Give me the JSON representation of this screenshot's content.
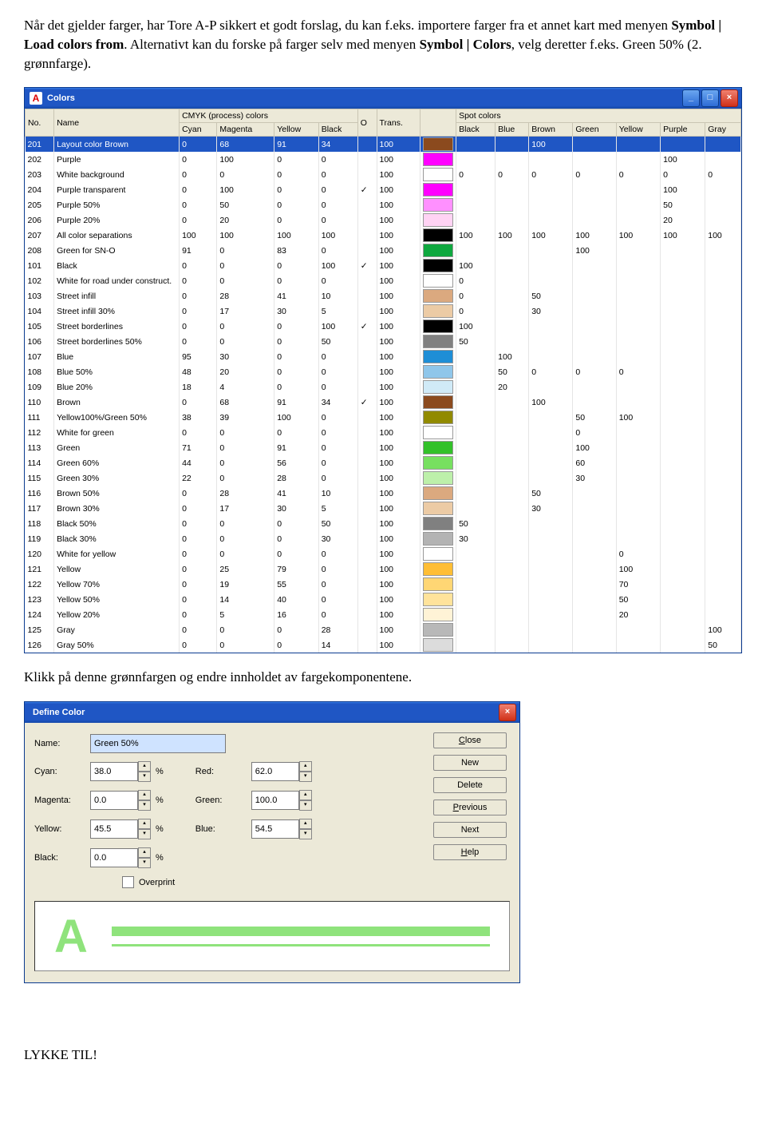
{
  "doc": {
    "p1a": "Når det gjelder farger, har Tore A-P sikkert et godt forslag, du kan f.eks. importere farger fra et annet kart med menyen ",
    "p1b": "Symbol | Load colors from",
    "p1c": ". Alternativt kan du forske på farger selv med menyen ",
    "p1d": "Symbol | Colors",
    "p1e": ", velg deretter f.eks. Green 50% (2. grønnfarge).",
    "p2": "Klikk på denne grønnfargen og endre innholdet av fargekomponentene.",
    "p3": "LYKKE TIL!"
  },
  "colorsWin": {
    "title": "Colors",
    "headers": {
      "no": "No.",
      "name": "Name",
      "group1": "CMYK (process) colors",
      "cyan": "Cyan",
      "mag": "Magenta",
      "yel": "Yellow",
      "blk": "Black",
      "o": "O",
      "trans": "Trans.",
      "group2": "Spot colors",
      "s_black": "Black",
      "s_blue": "Blue",
      "s_brown": "Brown",
      "s_green": "Green",
      "s_yellow": "Yellow",
      "s_purple": "Purple",
      "s_gray": "Gray"
    },
    "rows": [
      {
        "no": "201",
        "name": "Layout color Brown",
        "c": "0",
        "m": "68",
        "y": "91",
        "k": "34",
        "o": "",
        "t": "100",
        "sw": "#8b4a1e",
        "sc": {
          "brown": "100"
        }
      },
      {
        "no": "202",
        "name": "Purple",
        "c": "0",
        "m": "100",
        "y": "0",
        "k": "0",
        "o": "",
        "t": "100",
        "sw": "#ff00ff",
        "sc": {
          "purple": "100"
        }
      },
      {
        "no": "203",
        "name": "White background",
        "c": "0",
        "m": "0",
        "y": "0",
        "k": "0",
        "o": "",
        "t": "100",
        "sw": "#ffffff",
        "sc": {
          "black": "0",
          "blue": "0",
          "brown": "0",
          "green": "0",
          "yellow": "0",
          "purple": "0",
          "gray": "0"
        }
      },
      {
        "no": "204",
        "name": "Purple transparent",
        "c": "0",
        "m": "100",
        "y": "0",
        "k": "0",
        "o": "✓",
        "t": "100",
        "sw": "#ff00ff",
        "sc": {
          "purple": "100"
        }
      },
      {
        "no": "205",
        "name": "Purple 50%",
        "c": "0",
        "m": "50",
        "y": "0",
        "k": "0",
        "o": "",
        "t": "100",
        "sw": "#ff90ff",
        "sc": {
          "purple": "50"
        }
      },
      {
        "no": "206",
        "name": "Purple 20%",
        "c": "0",
        "m": "20",
        "y": "0",
        "k": "0",
        "o": "",
        "t": "100",
        "sw": "#ffd3f4",
        "sc": {
          "purple": "20"
        }
      },
      {
        "no": "207",
        "name": "All color separations",
        "c": "100",
        "m": "100",
        "y": "100",
        "k": "100",
        "o": "",
        "t": "100",
        "sw": "#000000",
        "sc": {
          "black": "100",
          "blue": "100",
          "brown": "100",
          "green": "100",
          "yellow": "100",
          "purple": "100",
          "gray": "100"
        }
      },
      {
        "no": "208",
        "name": "Green for SN-O",
        "c": "91",
        "m": "0",
        "y": "83",
        "k": "0",
        "o": "",
        "t": "100",
        "sw": "#0fa83f",
        "sc": {
          "green": "100"
        }
      },
      {
        "no": "101",
        "name": "Black",
        "c": "0",
        "m": "0",
        "y": "0",
        "k": "100",
        "o": "✓",
        "t": "100",
        "sw": "#000000",
        "sc": {
          "black": "100"
        }
      },
      {
        "no": "102",
        "name": "White for road under construct.",
        "c": "0",
        "m": "0",
        "y": "0",
        "k": "0",
        "o": "",
        "t": "100",
        "sw": "#ffffff",
        "sc": {
          "black": "0"
        }
      },
      {
        "no": "103",
        "name": "Street infill",
        "c": "0",
        "m": "28",
        "y": "41",
        "k": "10",
        "o": "",
        "t": "100",
        "sw": "#dba97f",
        "sc": {
          "black": "0",
          "brown": "50"
        }
      },
      {
        "no": "104",
        "name": "Street infill 30%",
        "c": "0",
        "m": "17",
        "y": "30",
        "k": "5",
        "o": "",
        "t": "100",
        "sw": "#eccba5",
        "sc": {
          "black": "0",
          "brown": "30"
        }
      },
      {
        "no": "105",
        "name": "Street borderlines",
        "c": "0",
        "m": "0",
        "y": "0",
        "k": "100",
        "o": "✓",
        "t": "100",
        "sw": "#000000",
        "sc": {
          "black": "100"
        }
      },
      {
        "no": "106",
        "name": "Street borderlines 50%",
        "c": "0",
        "m": "0",
        "y": "0",
        "k": "50",
        "o": "",
        "t": "100",
        "sw": "#808080",
        "sc": {
          "black": "50"
        }
      },
      {
        "no": "107",
        "name": "Blue",
        "c": "95",
        "m": "30",
        "y": "0",
        "k": "0",
        "o": "",
        "t": "100",
        "sw": "#1e8ed6",
        "sc": {
          "blue": "100"
        }
      },
      {
        "no": "108",
        "name": "Blue 50%",
        "c": "48",
        "m": "20",
        "y": "0",
        "k": "0",
        "o": "",
        "t": "100",
        "sw": "#8fc6ea",
        "sc": {
          "blue": "50",
          "brown": "0",
          "green": "0",
          "yellow": "0"
        }
      },
      {
        "no": "109",
        "name": "Blue 20%",
        "c": "18",
        "m": "4",
        "y": "0",
        "k": "0",
        "o": "",
        "t": "100",
        "sw": "#d0eaf7",
        "sc": {
          "blue": "20"
        }
      },
      {
        "no": "110",
        "name": "Brown",
        "c": "0",
        "m": "68",
        "y": "91",
        "k": "34",
        "o": "✓",
        "t": "100",
        "sw": "#8b4a1e",
        "sc": {
          "brown": "100"
        }
      },
      {
        "no": "111",
        "name": "Yellow100%/Green 50%",
        "c": "38",
        "m": "39",
        "y": "100",
        "k": "0",
        "o": "",
        "t": "100",
        "sw": "#918a00",
        "sc": {
          "green": "50",
          "yellow": "100"
        }
      },
      {
        "no": "112",
        "name": "White for green",
        "c": "0",
        "m": "0",
        "y": "0",
        "k": "0",
        "o": "",
        "t": "100",
        "sw": "#ffffff",
        "sc": {
          "green": "0"
        }
      },
      {
        "no": "113",
        "name": "Green",
        "c": "71",
        "m": "0",
        "y": "91",
        "k": "0",
        "o": "",
        "t": "100",
        "sw": "#33c12a",
        "sc": {
          "green": "100"
        }
      },
      {
        "no": "114",
        "name": "Green 60%",
        "c": "44",
        "m": "0",
        "y": "56",
        "k": "0",
        "o": "",
        "t": "100",
        "sw": "#77e060",
        "sc": {
          "green": "60"
        }
      },
      {
        "no": "115",
        "name": "Green 30%",
        "c": "22",
        "m": "0",
        "y": "28",
        "k": "0",
        "o": "",
        "t": "100",
        "sw": "#bdf0aa",
        "sc": {
          "green": "30"
        }
      },
      {
        "no": "116",
        "name": "Brown 50%",
        "c": "0",
        "m": "28",
        "y": "41",
        "k": "10",
        "o": "",
        "t": "100",
        "sw": "#dba97f",
        "sc": {
          "brown": "50"
        }
      },
      {
        "no": "117",
        "name": "Brown 30%",
        "c": "0",
        "m": "17",
        "y": "30",
        "k": "5",
        "o": "",
        "t": "100",
        "sw": "#eccba5",
        "sc": {
          "brown": "30"
        }
      },
      {
        "no": "118",
        "name": "Black 50%",
        "c": "0",
        "m": "0",
        "y": "0",
        "k": "50",
        "o": "",
        "t": "100",
        "sw": "#808080",
        "sc": {
          "black": "50"
        }
      },
      {
        "no": "119",
        "name": "Black 30%",
        "c": "0",
        "m": "0",
        "y": "0",
        "k": "30",
        "o": "",
        "t": "100",
        "sw": "#b3b3b3",
        "sc": {
          "black": "30"
        }
      },
      {
        "no": "120",
        "name": "White for yellow",
        "c": "0",
        "m": "0",
        "y": "0",
        "k": "0",
        "o": "",
        "t": "100",
        "sw": "#ffffff",
        "sc": {
          "yellow": "0"
        }
      },
      {
        "no": "121",
        "name": "Yellow",
        "c": "0",
        "m": "25",
        "y": "79",
        "k": "0",
        "o": "",
        "t": "100",
        "sw": "#ffbe35",
        "sc": {
          "yellow": "100"
        }
      },
      {
        "no": "122",
        "name": "Yellow 70%",
        "c": "0",
        "m": "19",
        "y": "55",
        "k": "0",
        "o": "",
        "t": "100",
        "sw": "#ffd674",
        "sc": {
          "yellow": "70"
        }
      },
      {
        "no": "123",
        "name": "Yellow 50%",
        "c": "0",
        "m": "14",
        "y": "40",
        "k": "0",
        "o": "",
        "t": "100",
        "sw": "#ffe39b",
        "sc": {
          "yellow": "50"
        }
      },
      {
        "no": "124",
        "name": "Yellow 20%",
        "c": "0",
        "m": "5",
        "y": "16",
        "k": "0",
        "o": "",
        "t": "100",
        "sw": "#fff3d6",
        "sc": {
          "yellow": "20"
        }
      },
      {
        "no": "125",
        "name": "Gray",
        "c": "0",
        "m": "0",
        "y": "0",
        "k": "28",
        "o": "",
        "t": "100",
        "sw": "#b8b8b8",
        "sc": {
          "gray": "100"
        }
      },
      {
        "no": "126",
        "name": "Gray 50%",
        "c": "0",
        "m": "0",
        "y": "0",
        "k": "14",
        "o": "",
        "t": "100",
        "sw": "#dcdcdc",
        "sc": {
          "gray": "50"
        }
      }
    ]
  },
  "dialog": {
    "title": "Define Color",
    "labels": {
      "name": "Name:",
      "cyan": "Cyan:",
      "mag": "Magenta:",
      "yel": "Yellow:",
      "blk": "Black:",
      "red": "Red:",
      "green": "Green:",
      "blue": "Blue:",
      "overprint": "Overprint",
      "pct": "%"
    },
    "values": {
      "name": "Green 50%",
      "cyan": "38.0",
      "mag": "0.0",
      "yel": "45.5",
      "blk": "0.0",
      "red": "62.0",
      "green": "100.0",
      "blue": "54.5"
    },
    "buttons": {
      "close": "Close",
      "new": "New",
      "delete": "Delete",
      "prev": "Previous",
      "next": "Next",
      "help": "Help"
    },
    "previewColor": "#8fe37c"
  }
}
